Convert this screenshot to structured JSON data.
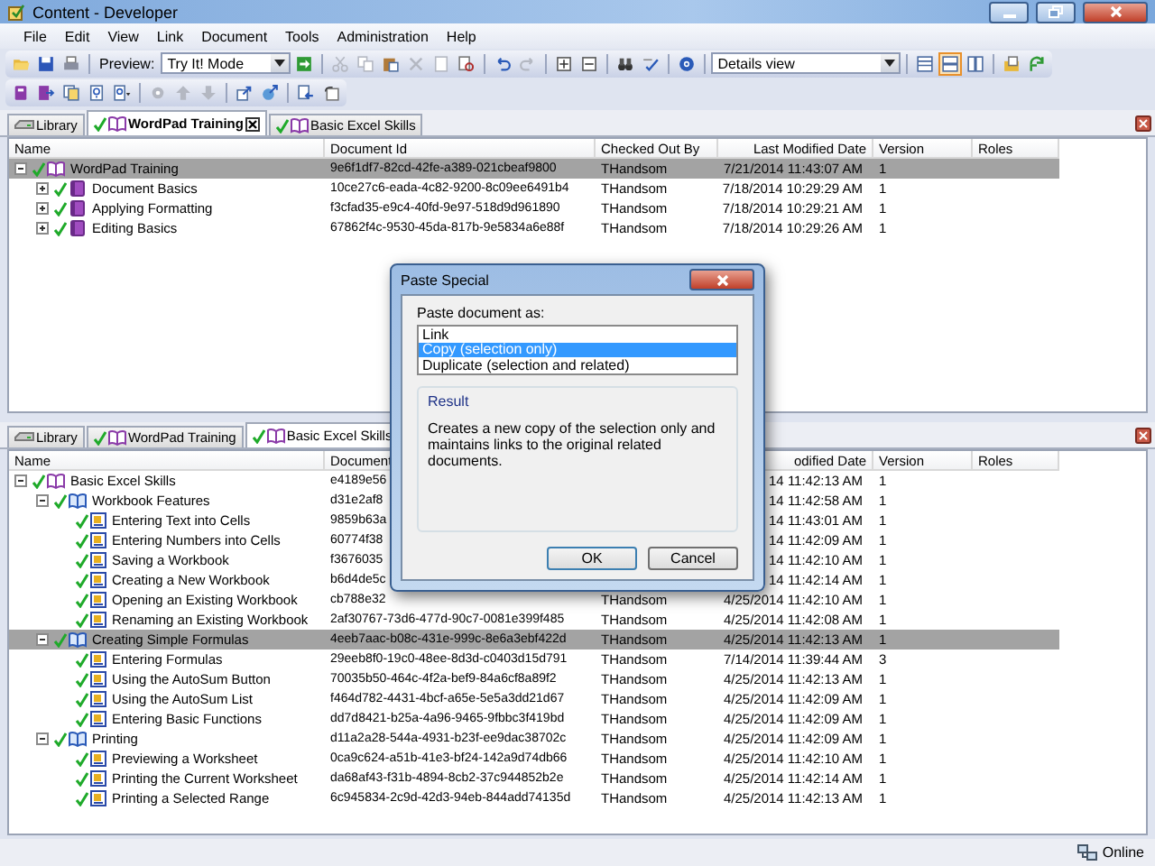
{
  "window": {
    "title": "Content - Developer"
  },
  "menu": [
    "File",
    "Edit",
    "View",
    "Link",
    "Document",
    "Tools",
    "Administration",
    "Help"
  ],
  "toolbars": [
    [
      {
        "kind": "folder"
      },
      {
        "kind": "floppy"
      },
      {
        "kind": "printer"
      },
      {
        "kind": "separator"
      },
      {
        "kind": "label",
        "text": "Preview:"
      },
      {
        "kind": "combo",
        "value": "Try It! Mode"
      },
      {
        "kind": "go"
      },
      {
        "kind": "separator"
      },
      {
        "kind": "scissors",
        "disabled": true
      },
      {
        "kind": "copy",
        "disabled": true
      },
      {
        "kind": "paste",
        "disabled": false
      },
      {
        "kind": "delete",
        "disabled": true
      },
      {
        "kind": "page",
        "disabled": true
      },
      {
        "kind": "magnifier"
      },
      {
        "kind": "separator"
      },
      {
        "kind": "undo",
        "disabled": false
      },
      {
        "kind": "redo",
        "disabled": true
      },
      {
        "kind": "separator"
      },
      {
        "kind": "expand"
      },
      {
        "kind": "collapse"
      },
      {
        "kind": "separator"
      },
      {
        "kind": "binoculars"
      },
      {
        "kind": "spellcheck"
      },
      {
        "kind": "separator"
      },
      {
        "kind": "help"
      },
      {
        "kind": "separator"
      },
      {
        "kind": "combo",
        "value": "Details view"
      },
      {
        "kind": "separator"
      },
      {
        "kind": "view-rows",
        "active": false
      },
      {
        "kind": "view-split",
        "active": true
      },
      {
        "kind": "view-columns",
        "active": false
      },
      {
        "kind": "separator"
      },
      {
        "kind": "properties"
      },
      {
        "kind": "refresh"
      }
    ],
    [
      {
        "kind": "book"
      },
      {
        "kind": "book-arrow"
      },
      {
        "kind": "pages"
      },
      {
        "kind": "question-page"
      },
      {
        "kind": "question-menu"
      },
      {
        "kind": "separator"
      },
      {
        "kind": "gear",
        "disabled": true
      },
      {
        "kind": "arrow-up",
        "disabled": true
      },
      {
        "kind": "arrow-down",
        "disabled": true
      },
      {
        "kind": "separator"
      },
      {
        "kind": "export"
      },
      {
        "kind": "export-globe"
      },
      {
        "kind": "separator"
      },
      {
        "kind": "import"
      },
      {
        "kind": "undo-page"
      }
    ]
  ],
  "panes": [
    {
      "focused": true,
      "tabs": [
        {
          "label": "Library",
          "kind": "library",
          "selected": false
        },
        {
          "label": "WordPad Training",
          "kind": "course",
          "selected": true
        },
        {
          "label": "Basic Excel Skills",
          "kind": "course",
          "selected": false
        }
      ],
      "columns": {
        "name": "Name",
        "id": "Document Id",
        "by": "Checked Out By",
        "date": "Last Modified Date",
        "version": "Version",
        "roles": "Roles"
      },
      "rows": [
        {
          "name": "WordPad Training",
          "kind": "course",
          "id": "9e6f1df7-82cd-42fe-a389-021cbeaf9800",
          "by": "THandsom",
          "date": "7/21/2014 11:43:07 AM",
          "version": "1",
          "selected": true,
          "expanded": true,
          "children": [
            {
              "name": "Document Basics",
              "kind": "lesson",
              "id": "10ce27c6-eada-4c82-9200-8c09ee6491b4",
              "by": "THandsom",
              "date": "7/18/2014 10:29:29 AM",
              "version": "1",
              "selected": false,
              "expanded": false
            },
            {
              "name": "Applying Formatting",
              "kind": "lesson",
              "id": "f3cfad35-e9c4-40fd-9e97-518d9d961890",
              "by": "THandsom",
              "date": "7/18/2014 10:29:21 AM",
              "version": "1",
              "selected": false,
              "expanded": false
            },
            {
              "name": "Editing Basics",
              "kind": "lesson",
              "id": "67862f4c-9530-45da-817b-9e5834a6e88f",
              "by": "THandsom",
              "date": "7/18/2014 10:29:26 AM",
              "version": "1",
              "selected": false,
              "expanded": false
            }
          ]
        }
      ]
    },
    {
      "focused": false,
      "tabs": [
        {
          "label": "Library",
          "kind": "library",
          "selected": false
        },
        {
          "label": "WordPad Training",
          "kind": "course",
          "selected": false
        },
        {
          "label": "Basic Excel Skills",
          "kind": "course",
          "selected": true
        }
      ],
      "columns": {
        "name": "Name",
        "id": "Document",
        "date": "odified Date",
        "version": "Version",
        "roles": "Roles"
      },
      "rows": [
        {
          "name": "Basic Excel Skills",
          "kind": "course",
          "id": "e4189e56",
          "date": "14 11:42:13 AM",
          "version": "1",
          "selected": false,
          "expanded": true,
          "children": [
            {
              "name": "Workbook Features",
              "kind": "module",
              "id": "d31e2af8",
              "date": "14 11:42:58 AM",
              "version": "1",
              "selected": false,
              "expanded": true,
              "children": [
                {
                  "name": "Entering Text into Cells",
                  "kind": "topic",
                  "id": "9859b63a",
                  "date": "14 11:43:01 AM",
                  "version": "1",
                  "selected": false
                },
                {
                  "name": "Entering Numbers into Cells",
                  "kind": "topic",
                  "id": "60774f38",
                  "date": "14 11:42:09 AM",
                  "version": "1",
                  "selected": false
                },
                {
                  "name": "Saving a Workbook",
                  "kind": "topic",
                  "id": "f3676035",
                  "date": "14 11:42:10 AM",
                  "version": "1",
                  "selected": false
                },
                {
                  "name": "Creating a New Workbook",
                  "kind": "topic",
                  "id": "b6d4de5c",
                  "date": "14 11:42:14 AM",
                  "version": "1",
                  "selected": false
                },
                {
                  "name": "Opening an Existing Workbook",
                  "kind": "topic",
                  "id": "cb788e32",
                  "by": "THandsom",
                  "date": "4/25/2014 11:42:10 AM",
                  "version": "1",
                  "selected": false
                },
                {
                  "name": "Renaming an Existing Workbook",
                  "kind": "topic",
                  "id": "2af30767-73d6-477d-90c7-0081e399f485",
                  "by": "THandsom",
                  "date": "4/25/2014 11:42:08 AM",
                  "version": "1",
                  "selected": false
                }
              ]
            },
            {
              "name": "Creating Simple Formulas",
              "kind": "module",
              "id": "4eeb7aac-b08c-431e-999c-8e6a3ebf422d",
              "by": "THandsom",
              "date": "4/25/2014 11:42:13 AM",
              "version": "1",
              "selected": true,
              "expanded": true,
              "children": [
                {
                  "name": "Entering Formulas",
                  "kind": "topic",
                  "id": "29eeb8f0-19c0-48ee-8d3d-c0403d15d791",
                  "by": "THandsom",
                  "date": "7/14/2014 11:39:44 AM",
                  "version": "3",
                  "selected": false
                },
                {
                  "name": "Using the AutoSum Button",
                  "kind": "topic",
                  "id": "70035b50-464c-4f2a-bef9-84a6cf8a89f2",
                  "by": "THandsom",
                  "date": "4/25/2014 11:42:13 AM",
                  "version": "1",
                  "selected": false
                },
                {
                  "name": "Using the AutoSum List",
                  "kind": "topic",
                  "id": "f464d782-4431-4bcf-a65e-5e5a3dd21d67",
                  "by": "THandsom",
                  "date": "4/25/2014 11:42:09 AM",
                  "version": "1",
                  "selected": false
                },
                {
                  "name": "Entering Basic Functions",
                  "kind": "topic",
                  "id": "dd7d8421-b25a-4a96-9465-9fbbc3f419bd",
                  "by": "THandsom",
                  "date": "4/25/2014 11:42:09 AM",
                  "version": "1",
                  "selected": false
                }
              ]
            },
            {
              "name": "Printing",
              "kind": "module",
              "id": "d11a2a28-544a-4931-b23f-ee9dac38702c",
              "by": "THandsom",
              "date": "4/25/2014 11:42:09 AM",
              "version": "1",
              "selected": false,
              "expanded": true,
              "children": [
                {
                  "name": "Previewing a Worksheet",
                  "kind": "topic",
                  "id": "0ca9c624-a51b-41e3-bf24-142a9d74db66",
                  "by": "THandsom",
                  "date": "4/25/2014 11:42:10 AM",
                  "version": "1",
                  "selected": false
                },
                {
                  "name": "Printing the Current Worksheet",
                  "kind": "topic",
                  "id": "da68af43-f31b-4894-8cb2-37c944852b2e",
                  "by": "THandsom",
                  "date": "4/25/2014 11:42:14 AM",
                  "version": "1",
                  "selected": false
                },
                {
                  "name": "Printing a Selected Range",
                  "kind": "topic",
                  "id": "6c945834-2c9d-42d3-94eb-844add74135d",
                  "by": "THandsom",
                  "date": "4/25/2014 11:42:13 AM",
                  "version": "1",
                  "selected": false
                }
              ]
            }
          ]
        }
      ]
    }
  ],
  "dialog": {
    "title": "Paste Special",
    "prompt": "Paste document as:",
    "options": [
      {
        "label": "Link",
        "selected": false
      },
      {
        "label": "Copy (selection only)",
        "selected": true
      },
      {
        "label": "Duplicate (selection and related)",
        "selected": false
      }
    ],
    "group": "Result",
    "description": "Creates a new copy of the selection only and maintains links to the original related documents.",
    "buttons": [
      {
        "label": "OK",
        "default": true
      },
      {
        "label": "Cancel",
        "default": false
      }
    ]
  },
  "status_bar": {
    "text": "Online"
  }
}
